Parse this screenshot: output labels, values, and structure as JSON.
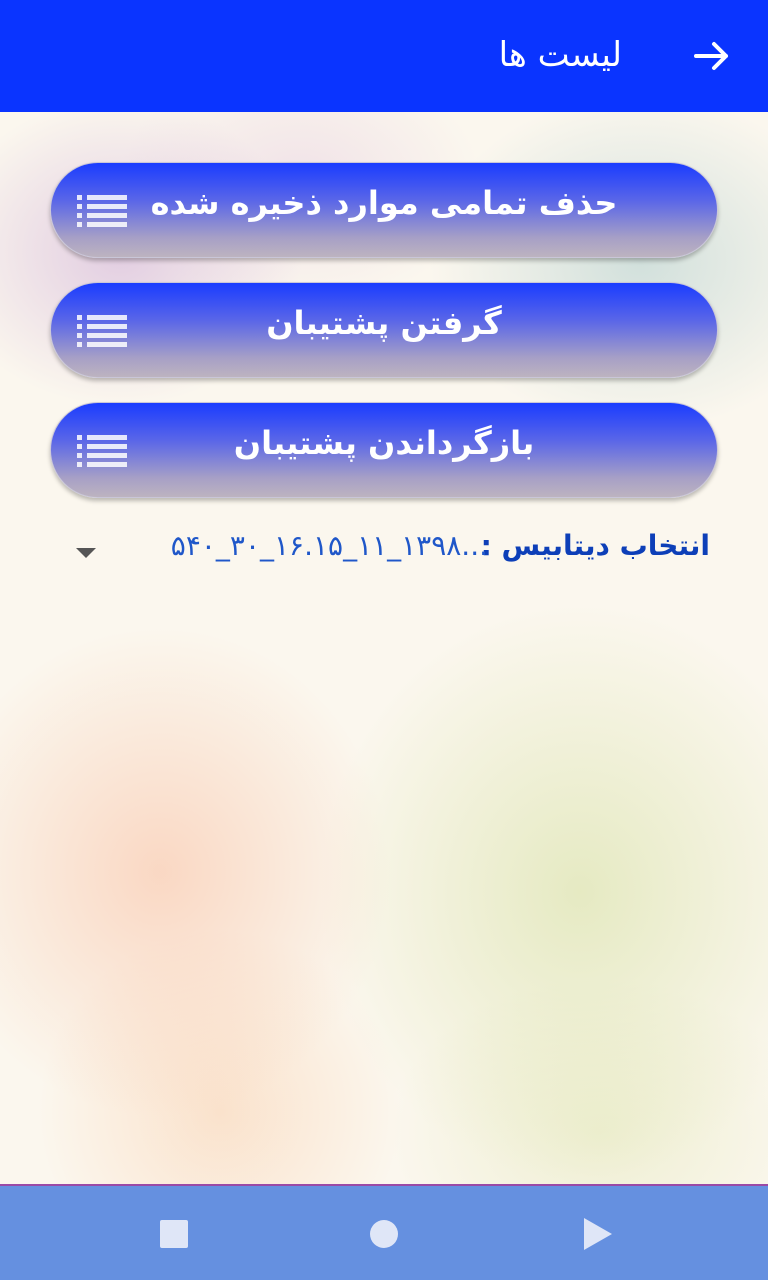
{
  "app_bar": {
    "title": "لیست ها",
    "back_icon": "arrow-right-icon",
    "background": "#0a34ff"
  },
  "buttons": [
    {
      "label": "حذف تمامی موارد ذخیره شده",
      "icon": "list-icon"
    },
    {
      "label": "گرفتن پشتیبان",
      "icon": "list-icon"
    },
    {
      "label": "بازگرداندن پشتیبان",
      "icon": "list-icon"
    }
  ],
  "database_select": {
    "label": "انتخاب دیتابیس :",
    "selected_value": "...۱۳۹۸_۱۱_۱۶.۱۵_۳۰_۵۴۰",
    "arrow_icon": "dropdown-arrow-icon"
  },
  "nav_bar": {
    "background": "#6590e0",
    "items": [
      "recents-icon",
      "home-icon",
      "back-triangle-icon"
    ]
  }
}
